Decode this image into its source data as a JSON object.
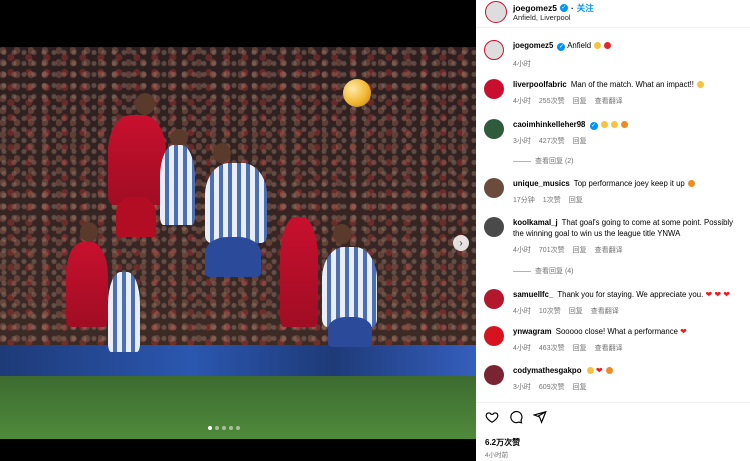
{
  "post": {
    "author": "joegomez5",
    "follow_label": "关注",
    "location": "Anfield, Liverpool",
    "caption_user": "joegomez5",
    "caption_text": "Anfield",
    "caption_time": "4小时",
    "carousel": {
      "total_slides": 5,
      "active_slide": 1
    }
  },
  "comments": [
    {
      "user": "liverpoolfabric",
      "text": "Man of the match. What an impact!!",
      "time": "4小时",
      "likes": "255次赞",
      "reply": "回复",
      "translate": "查看翻译",
      "avatar_color": "#c8102e"
    },
    {
      "user": "caoimhinkelleher98",
      "text": "",
      "time": "3小时",
      "likes": "427次赞",
      "reply": "回复",
      "more_replies": "查看回复 (2)",
      "avatar_color": "#2e5b3a"
    },
    {
      "user": "unique_musics",
      "text": "Top performance joey keep it up",
      "time": "17分钟",
      "likes": "1次赞",
      "reply": "回复",
      "avatar_color": "#6b4b3b"
    },
    {
      "user": "koolkamal_j",
      "text": "That goal's going to come at some point. Possibly the winning goal to win us the league title YNWA",
      "time": "4小时",
      "likes": "701次赞",
      "reply": "回复",
      "translate": "查看翻译",
      "more_replies": "查看回复 (4)",
      "avatar_color": "#4a4a4a"
    },
    {
      "user": "samuellfc_",
      "text": "Thank you for staying. We appreciate you.",
      "time": "4小时",
      "likes": "10次赞",
      "reply": "回复",
      "translate": "查看翻译",
      "avatar_color": "#b3172b"
    },
    {
      "user": "ynwagram",
      "text": "Sooooo close! What a performance",
      "time": "4小时",
      "likes": "463次赞",
      "reply": "回复",
      "translate": "查看翻译",
      "avatar_color": "#d7131f"
    },
    {
      "user": "codymathesgakpo",
      "text": "",
      "time": "3小时",
      "likes": "609次赞",
      "reply": "回复",
      "avatar_color": "#7a2331"
    }
  ],
  "footer": {
    "likes": "6.2万次赞",
    "time": "4小时前"
  },
  "icons": [
    "verified-icon",
    "heart-icon",
    "comment-icon",
    "share-icon",
    "chevron-right-icon"
  ],
  "colors": {
    "accent": "#0095f6",
    "liverpool_red": "#c8102e",
    "muted": "#737373"
  }
}
